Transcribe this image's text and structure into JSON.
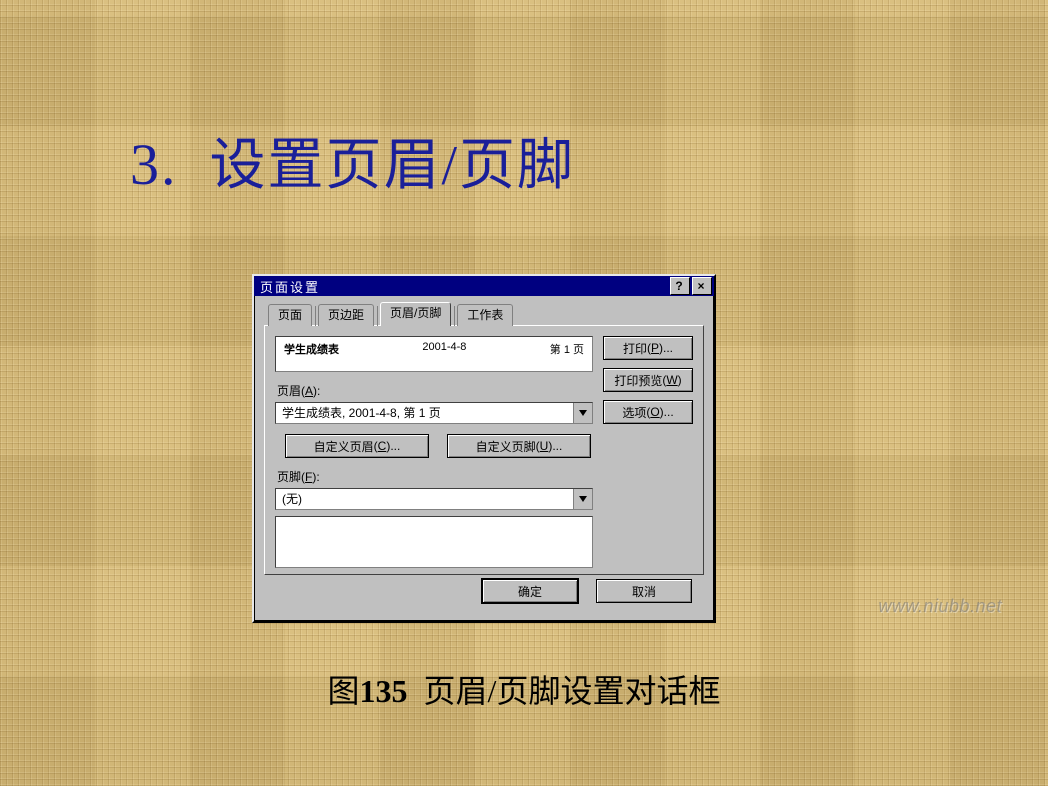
{
  "heading": {
    "number": "3.",
    "text": "设置页眉/页脚"
  },
  "dialog": {
    "title": "页面设置",
    "help_label": "?",
    "close_label": "×",
    "tabs": {
      "page": "页面",
      "margins": "页边距",
      "hf": "页眉/页脚",
      "sheet": "工作表"
    },
    "side_buttons": {
      "print": {
        "text": "打印",
        "accel": "P",
        "tail": "..."
      },
      "preview": {
        "text": "打印预览",
        "accel": "W",
        "tail": ""
      },
      "options": {
        "text": "选项",
        "accel": "O",
        "tail": "..."
      }
    },
    "header_preview": {
      "left": "学生成绩表",
      "center": "2001-4-8",
      "right": "第 1 页"
    },
    "labels": {
      "header": {
        "text": "页眉",
        "accel": "A",
        "tail": ":"
      },
      "footer": {
        "text": "页脚",
        "accel": "F",
        "tail": ":"
      }
    },
    "header_combo": "学生成绩表, 2001-4-8,  第 1 页",
    "footer_combo": "(无)",
    "custom_buttons": {
      "header": {
        "text": "自定义页眉",
        "accel": "C",
        "tail": "..."
      },
      "footer": {
        "text": "自定义页脚",
        "accel": "U",
        "tail": "..."
      }
    },
    "footer_buttons": {
      "ok": "确定",
      "cancel": "取消"
    }
  },
  "caption": {
    "prefix": "图",
    "number": "135",
    "text": "页眉/页脚设置对话框"
  },
  "watermark": "www.niubb.net"
}
